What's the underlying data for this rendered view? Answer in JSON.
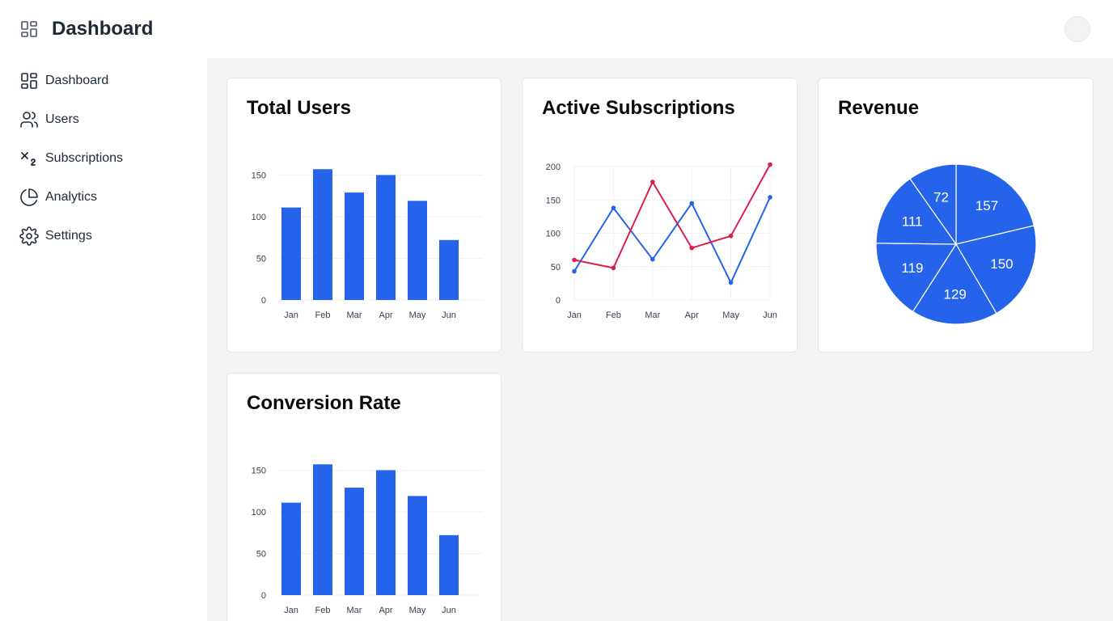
{
  "header": {
    "title": "Dashboard",
    "logo_icon": "grid-icon",
    "avatar_icon": "avatar"
  },
  "sidebar": {
    "items": [
      {
        "label": "Dashboard",
        "icon": "grid-icon"
      },
      {
        "label": "Users",
        "icon": "users-icon"
      },
      {
        "label": "Subscriptions",
        "icon": "subscript-icon"
      },
      {
        "label": "Analytics",
        "icon": "pie-chart-icon"
      },
      {
        "label": "Settings",
        "icon": "gear-icon"
      }
    ]
  },
  "colors": {
    "accent_blue": "#2563eb",
    "accent_red": "#dc1f4a",
    "background": "#f3f4f6"
  },
  "cards": {
    "total_users": {
      "title": "Total Users"
    },
    "active_subscriptions": {
      "title": "Active Subscriptions"
    },
    "revenue": {
      "title": "Revenue"
    },
    "conversion_rate": {
      "title": "Conversion Rate"
    }
  },
  "chart_data": [
    {
      "id": "total_users",
      "type": "bar",
      "categories": [
        "Jan",
        "Feb",
        "Mar",
        "Apr",
        "May",
        "Jun"
      ],
      "values": [
        111,
        157,
        129,
        150,
        119,
        72
      ],
      "yticks": [
        0,
        50,
        100,
        150
      ],
      "ylim": [
        0,
        165
      ],
      "grid": true,
      "color": "#2563eb"
    },
    {
      "id": "active_subscriptions",
      "type": "line",
      "categories": [
        "Jan",
        "Feb",
        "Mar",
        "Apr",
        "May",
        "Jun"
      ],
      "series": [
        {
          "values": [
            43,
            138,
            61,
            145,
            26,
            154
          ],
          "color": "#2563eb"
        },
        {
          "values": [
            60,
            48,
            177,
            78,
            96,
            203
          ],
          "color": "#dc1f4a"
        }
      ],
      "yticks": [
        0,
        50,
        100,
        150,
        200
      ],
      "ylim": [
        0,
        200
      ],
      "grid": true
    },
    {
      "id": "revenue",
      "type": "pie",
      "values": [
        157,
        150,
        129,
        119,
        111,
        72
      ],
      "color": "#2563eb"
    },
    {
      "id": "conversion_rate",
      "type": "bar",
      "categories": [
        "Jan",
        "Feb",
        "Mar",
        "Apr",
        "May",
        "Jun"
      ],
      "values": [
        111,
        157,
        129,
        150,
        119,
        72
      ],
      "yticks": [
        0,
        50,
        100,
        150
      ],
      "ylim": [
        0,
        165
      ],
      "grid": true,
      "color": "#2563eb"
    }
  ]
}
